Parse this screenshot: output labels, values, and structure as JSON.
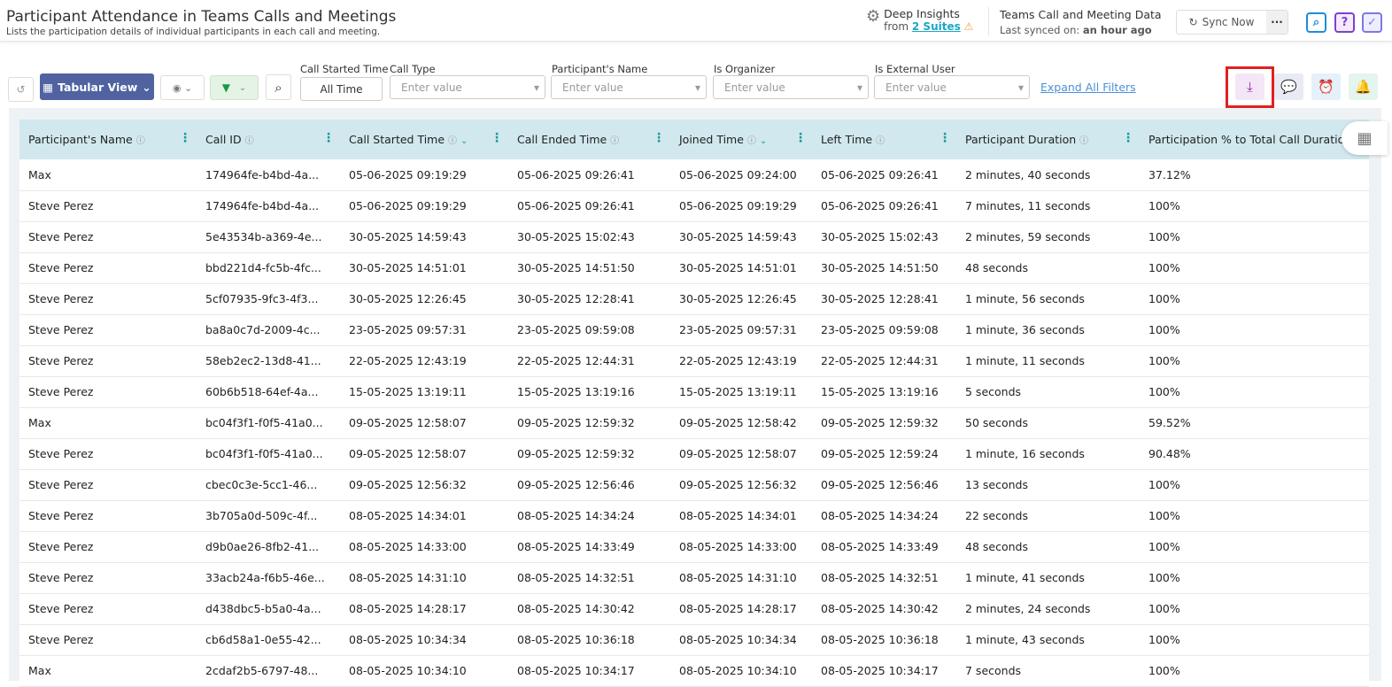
{
  "header": {
    "title": "Participant Attendance in Teams Calls and Meetings",
    "subtitle": "Lists the participation details of individual participants in each call and meeting.",
    "insights_label": "Deep Insights",
    "insights_from": "from",
    "insights_link": "2 Suites",
    "data_title": "Teams Call and Meeting Data",
    "last_synced_label": "Last synced on:",
    "last_synced_value": "an hour ago",
    "sync_label": "Sync Now",
    "more_label": "···"
  },
  "toolbar": {
    "view_label": "Tabular View",
    "expand_label": "Expand All Filters"
  },
  "filters": [
    {
      "label": "Call Started Time",
      "value": "All Time"
    },
    {
      "label": "Call Type",
      "placeholder": "Enter value"
    },
    {
      "label": "Participant's Name",
      "placeholder": "Enter value"
    },
    {
      "label": "Is Organizer",
      "placeholder": "Enter value"
    },
    {
      "label": "Is External User",
      "placeholder": "Enter value"
    }
  ],
  "table": {
    "columns": [
      "Participant's Name",
      "Call ID",
      "Call Started Time",
      "Call Ended Time",
      "Joined Time",
      "Left Time",
      "Participant Duration",
      "Participation % to Total Call Duration"
    ],
    "rows": [
      [
        "Max",
        "174964fe-b4bd-4a...",
        "05-06-2025 09:19:29",
        "05-06-2025 09:26:41",
        "05-06-2025 09:24:00",
        "05-06-2025 09:26:41",
        "2 minutes, 40 seconds",
        "37.12%"
      ],
      [
        "Steve Perez",
        "174964fe-b4bd-4a...",
        "05-06-2025 09:19:29",
        "05-06-2025 09:26:41",
        "05-06-2025 09:19:29",
        "05-06-2025 09:26:41",
        "7 minutes, 11 seconds",
        "100%"
      ],
      [
        "Steve Perez",
        "5e43534b-a369-4e...",
        "30-05-2025 14:59:43",
        "30-05-2025 15:02:43",
        "30-05-2025 14:59:43",
        "30-05-2025 15:02:43",
        "2 minutes, 59 seconds",
        "100%"
      ],
      [
        "Steve Perez",
        "bbd221d4-fc5b-4fc...",
        "30-05-2025 14:51:01",
        "30-05-2025 14:51:50",
        "30-05-2025 14:51:01",
        "30-05-2025 14:51:50",
        "48 seconds",
        "100%"
      ],
      [
        "Steve Perez",
        "5cf07935-9fc3-4f3...",
        "30-05-2025 12:26:45",
        "30-05-2025 12:28:41",
        "30-05-2025 12:26:45",
        "30-05-2025 12:28:41",
        "1 minute, 56 seconds",
        "100%"
      ],
      [
        "Steve Perez",
        "ba8a0c7d-2009-4c...",
        "23-05-2025 09:57:31",
        "23-05-2025 09:59:08",
        "23-05-2025 09:57:31",
        "23-05-2025 09:59:08",
        "1 minute, 36 seconds",
        "100%"
      ],
      [
        "Steve Perez",
        "58eb2ec2-13d8-41...",
        "22-05-2025 12:43:19",
        "22-05-2025 12:44:31",
        "22-05-2025 12:43:19",
        "22-05-2025 12:44:31",
        "1 minute, 11 seconds",
        "100%"
      ],
      [
        "Steve Perez",
        "60b6b518-64ef-4a...",
        "15-05-2025 13:19:11",
        "15-05-2025 13:19:16",
        "15-05-2025 13:19:11",
        "15-05-2025 13:19:16",
        "5 seconds",
        "100%"
      ],
      [
        "Max",
        "bc04f3f1-f0f5-41a0...",
        "09-05-2025 12:58:07",
        "09-05-2025 12:59:32",
        "09-05-2025 12:58:42",
        "09-05-2025 12:59:32",
        "50 seconds",
        "59.52%"
      ],
      [
        "Steve Perez",
        "bc04f3f1-f0f5-41a0...",
        "09-05-2025 12:58:07",
        "09-05-2025 12:59:32",
        "09-05-2025 12:58:07",
        "09-05-2025 12:59:24",
        "1 minute, 16 seconds",
        "90.48%"
      ],
      [
        "Steve Perez",
        "cbec0c3e-5cc1-46...",
        "09-05-2025 12:56:32",
        "09-05-2025 12:56:46",
        "09-05-2025 12:56:32",
        "09-05-2025 12:56:46",
        "13 seconds",
        "100%"
      ],
      [
        "Steve Perez",
        "3b705a0d-509c-4f...",
        "08-05-2025 14:34:01",
        "08-05-2025 14:34:24",
        "08-05-2025 14:34:01",
        "08-05-2025 14:34:24",
        "22 seconds",
        "100%"
      ],
      [
        "Steve Perez",
        "d9b0ae26-8fb2-41...",
        "08-05-2025 14:33:00",
        "08-05-2025 14:33:49",
        "08-05-2025 14:33:00",
        "08-05-2025 14:33:49",
        "48 seconds",
        "100%"
      ],
      [
        "Steve Perez",
        "33acb24a-f6b5-46e...",
        "08-05-2025 14:31:10",
        "08-05-2025 14:32:51",
        "08-05-2025 14:31:10",
        "08-05-2025 14:32:51",
        "1 minute, 41 seconds",
        "100%"
      ],
      [
        "Steve Perez",
        "d438dbc5-b5a0-4a...",
        "08-05-2025 14:28:17",
        "08-05-2025 14:30:42",
        "08-05-2025 14:28:17",
        "08-05-2025 14:30:42",
        "2 minutes, 24 seconds",
        "100%"
      ],
      [
        "Steve Perez",
        "cb6d58a1-0e55-42...",
        "08-05-2025 10:34:34",
        "08-05-2025 10:36:18",
        "08-05-2025 10:34:34",
        "08-05-2025 10:36:18",
        "1 minute, 43 seconds",
        "100%"
      ],
      [
        "Max",
        "2cdaf2b5-6797-48...",
        "08-05-2025 10:34:10",
        "08-05-2025 10:34:17",
        "08-05-2025 10:34:10",
        "08-05-2025 10:34:17",
        "7 seconds",
        "100%"
      ]
    ]
  },
  "colors": {
    "primary": "#5063a0",
    "header_bg": "#d1e8ee",
    "highlight": "#e02020",
    "link": "#1aa7c4"
  }
}
